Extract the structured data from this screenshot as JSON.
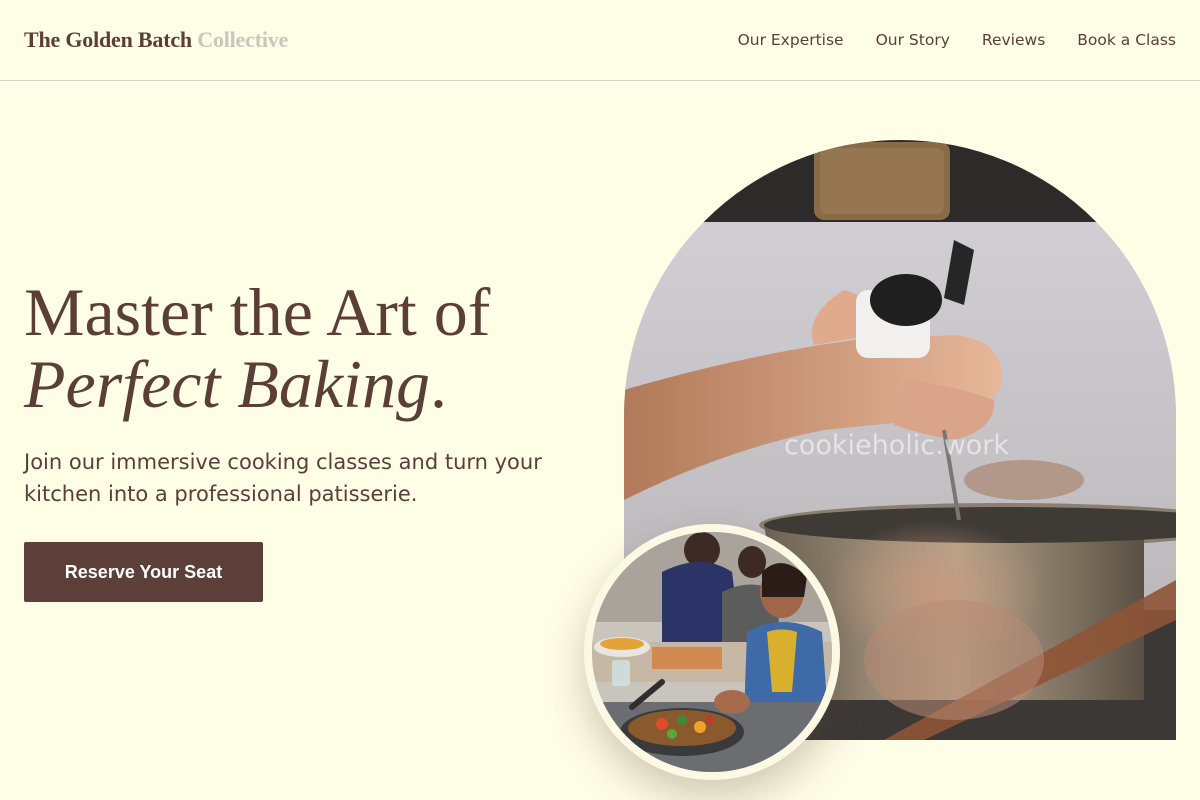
{
  "header": {
    "brand_primary": "The Golden Batch",
    "brand_secondary": "Collective",
    "nav": [
      {
        "label": "Our Expertise"
      },
      {
        "label": "Our Story"
      },
      {
        "label": "Reviews"
      },
      {
        "label": "Book a Class"
      }
    ]
  },
  "hero": {
    "title_line1": "Master the Art of",
    "title_line2": "Perfect Baking",
    "title_punct": ".",
    "subtitle": "Join our immersive cooking classes and turn your kitchen into a professional patisserie.",
    "cta_label": "Reserve Your Seat"
  },
  "images": {
    "main_watermark": "cookieholic.work"
  },
  "colors": {
    "background": "#fefde6",
    "primary_brown": "#5c3f38",
    "muted_text": "#c9c6bd"
  }
}
